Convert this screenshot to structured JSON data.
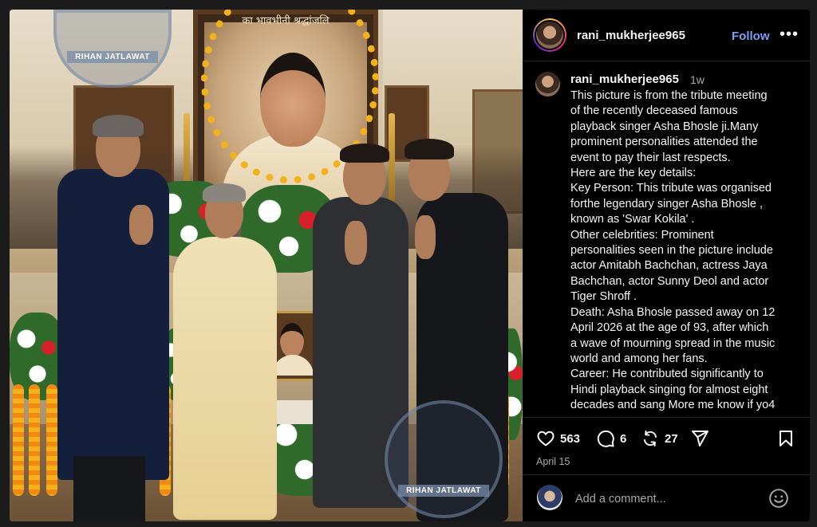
{
  "post": {
    "username": "rani_mukherjee965",
    "follow_label": "Follow",
    "more_label": "•••",
    "time_ago": "1w",
    "caption_lines": [
      "This picture is from the tribute meeting",
      "of the recently deceased famous",
      "playback singer Asha Bhosle ji.Many",
      "prominent personalities attended the",
      "event to pay their last respects.",
      "Here are the key details:",
      "Key Person: This tribute was organised",
      "forthe legendary singer Asha Bhosle ,",
      "known as 'Swar Kokila' .",
      "Other celebrities: Prominent",
      "personalities seen in the picture include",
      "actor Amitabh Bachchan, actress Jaya",
      "Bachchan, actor Sunny Deol and actor",
      "Tiger Shroff .",
      "Death: Asha Bhosle passed away on 12",
      "April 2026 at the age of 93, after which",
      "a wave of mourning spread in the music",
      "world and among her fans.",
      "Career: He contributed significantly to",
      "Hindi playback singing for almost eight",
      "decades and sang More me know if yo4"
    ],
    "likes": "563",
    "comments": "6",
    "shares": "27",
    "date": "April 15",
    "comment_placeholder": "Add a comment..."
  },
  "photo": {
    "portrait_heading": "का भावभीनी श्रद्धांजलि",
    "watermark_text": "RIHAN JATLAWAT"
  },
  "icons": {
    "like": "heart-icon",
    "comment": "comment-icon",
    "share": "repost-icon",
    "send": "send-icon",
    "save": "bookmark-icon",
    "emoji": "emoji-icon"
  },
  "colors": {
    "accent": "#7b9df5",
    "background": "#000000",
    "muted": "#a8a8a8"
  }
}
